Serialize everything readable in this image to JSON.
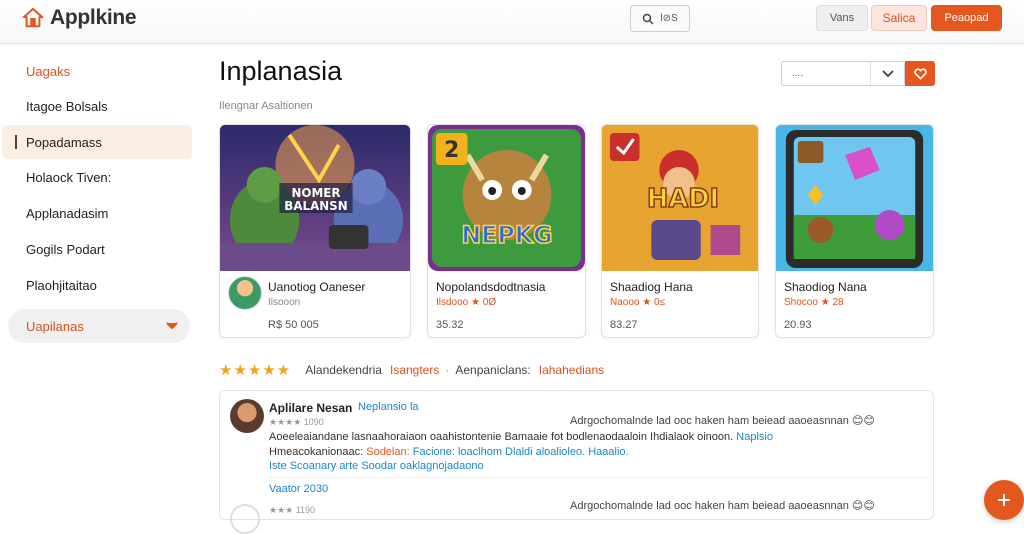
{
  "app": {
    "logo_text": "Applkine"
  },
  "header": {
    "search_label": "l⊘S",
    "btn_views": "Vans",
    "btn_sales": "Salica",
    "btn_primary": "Peaopad"
  },
  "sidebar": {
    "items": [
      {
        "label": "Uagaks"
      },
      {
        "label": "Itagoe Bolsals"
      },
      {
        "label": "Popadamass"
      },
      {
        "label": "Holaock Tiven:"
      },
      {
        "label": "Applanadasim"
      },
      {
        "label": "Gogils Podart"
      },
      {
        "label": "Plaohjitaitao"
      },
      {
        "label": "Uapilanas"
      }
    ]
  },
  "main": {
    "title": "Inplanasia",
    "subtitle": "Ilengnar Asaltionen",
    "sort_value": "....",
    "cards": [
      {
        "name": "Uanotiog Oaneser",
        "meta": "Ilsooon",
        "price": "R$ 50 005"
      },
      {
        "name": "Nopolandsdodtnasia",
        "meta": "Ilsdooo ★ 0Ø",
        "price": "35.32"
      },
      {
        "name": "Shaadiog Hana",
        "meta": "Naooo ★ 0≤",
        "price": "83.27"
      },
      {
        "name": "Shaodiog Nana",
        "meta": "Shocoo ★ 28",
        "price": "20.93"
      }
    ],
    "ratings": {
      "stars": "★★★★★",
      "label": "Alandekendria",
      "tag1": "Isangters",
      "label2": "Aenpaniclans:",
      "tag2": "Iahahedians"
    },
    "review": {
      "name": "Aplilare Nesan",
      "tag": "Neplansio la",
      "stars": "★★★★ 1090",
      "right_text": "Adrgochomalnde lad ooc haken ham beiead aaoeasnnan 😊😊",
      "line1": "Aoeeleaiandane lasnaahoraiaon oaahistontenie Bamaaie fot bodlenaodaaloin Ihdialaok oinoon.",
      "line1_tail": "Naplsio",
      "line2_start": "Hmeacokanionaac:",
      "line2_orange": "Sodelan:",
      "line2_blue": "Facione: loaclhom Dlaldi aloalioleo. Haaalio.",
      "line3": "Iste Scoanary arte Soodar oaklagnojadaono",
      "reply_tag": "Vaator 2030",
      "reply_stars": "★★★ 1190",
      "reply_right": "Adrgochomalnde lad ooc haken ham beiead aaoeasnnan 😊😊"
    }
  },
  "colors": {
    "accent": "#e4571e",
    "accent_light": "#fbe5dc",
    "link": "#1a86c9",
    "star": "#f3a21b"
  }
}
